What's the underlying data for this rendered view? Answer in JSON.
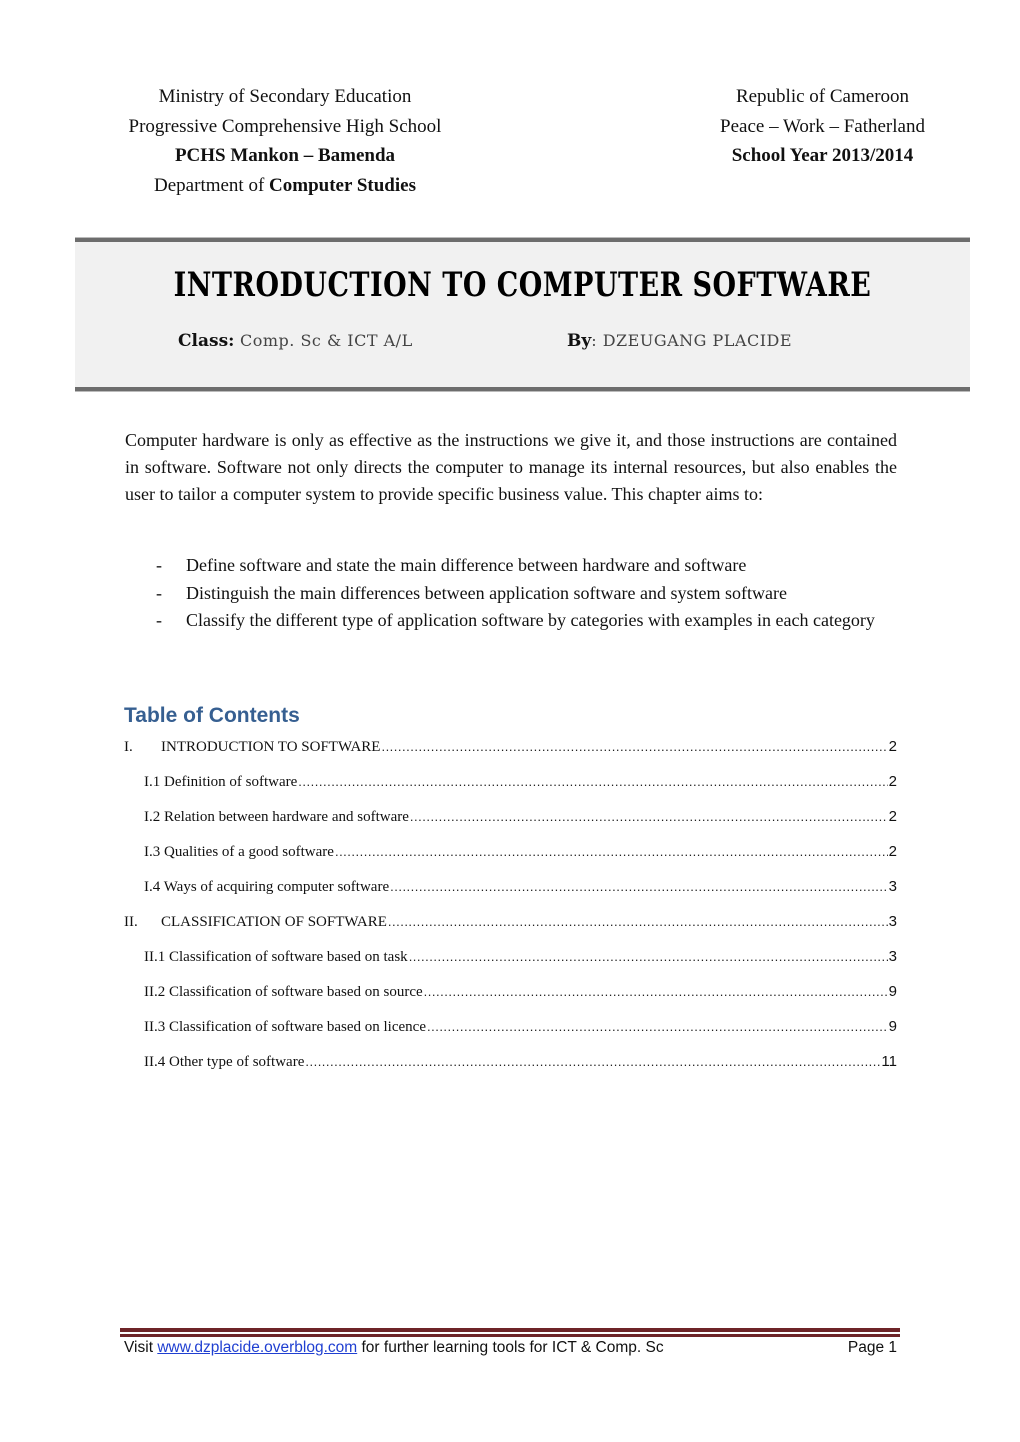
{
  "header": {
    "left": {
      "line1": "Ministry of Secondary Education",
      "line2": "Progressive Comprehensive High School",
      "line3": "PCHS Mankon – Bamenda",
      "line4_prefix": "Department of ",
      "line4_bold": "Computer Studies"
    },
    "right": {
      "line1": "Republic of Cameroon",
      "line2": "Peace – Work – Fatherland",
      "line3": "School Year 2013/2014"
    }
  },
  "title_box": {
    "title": "INTRODUCTION TO COMPUTER SOFTWARE",
    "class_label": "Class:",
    "class_value": " Comp. Sc & ICT A/L",
    "by_label": "By",
    "by_value": ": DZEUGANG PLACIDE"
  },
  "intro": {
    "paragraph": "Computer hardware is only as effective as the instructions we give it, and those instructions are contained in software. Software not only directs the computer to manage its internal resources, but also enables the user to tailor a computer system to provide specific business value. This chapter aims to:",
    "bullet_marker": "-",
    "aims": [
      "Define software and state the main difference between hardware and software",
      "Distinguish the main differences between application software and system software",
      "Classify the different type of application software by categories with examples in each category"
    ]
  },
  "toc": {
    "title": "Table of Contents",
    "entries": [
      {
        "num": "I.",
        "label": "INTRODUCTION TO SOFTWARE",
        "page": "2",
        "level": 1
      },
      {
        "num": "",
        "label": "I.1 Definition of software",
        "page": "2",
        "level": 2
      },
      {
        "num": "",
        "label": "I.2 Relation between hardware and software",
        "page": "2",
        "level": 2
      },
      {
        "num": "",
        "label": "I.3 Qualities of a good software",
        "page": "2",
        "level": 2
      },
      {
        "num": "",
        "label": "I.4 Ways of acquiring computer software",
        "page": "3",
        "level": 2
      },
      {
        "num": "II.",
        "label": "CLASSIFICATION OF SOFTWARE",
        "page": "3",
        "level": 1
      },
      {
        "num": "",
        "label": "II.1 Classification of software based on task",
        "page": "3",
        "level": 2
      },
      {
        "num": "",
        "label": "II.2 Classification of software based on source",
        "page": "9",
        "level": 2
      },
      {
        "num": "",
        "label": "II.3 Classification of software based on licence",
        "page": "9",
        "level": 2
      },
      {
        "num": "",
        "label": "II.4 Other type of software",
        "page": "11",
        "level": 2
      }
    ]
  },
  "footer": {
    "prefix": "Visit ",
    "link_text": "www.dzplacide.overblog.com",
    "suffix": " for further learning tools for ICT & Comp. Sc",
    "page_label": "Page 1",
    "rule_color": "#6e2428",
    "link_color": "#1f3fd1"
  },
  "colors": {
    "toc_title": "#365f91",
    "title_box_bg": "#f1f1f1"
  }
}
